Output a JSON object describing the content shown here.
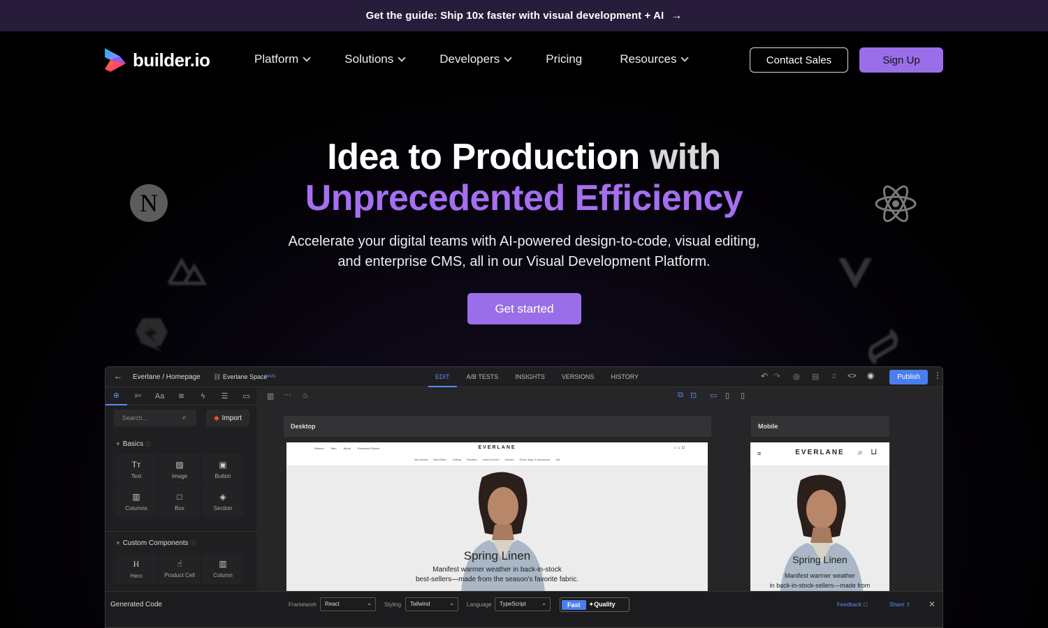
{
  "announcement": {
    "text": "Get the guide: Ship 10x faster with visual development + AI",
    "arrow": "→"
  },
  "nav": {
    "logo_text": "builder.io",
    "items": [
      {
        "label": "Platform",
        "dropdown": true
      },
      {
        "label": "Solutions",
        "dropdown": true
      },
      {
        "label": "Developers",
        "dropdown": true
      },
      {
        "label": "Pricing",
        "dropdown": false
      },
      {
        "label": "Resources",
        "dropdown": true
      }
    ],
    "contact_label": "Contact Sales",
    "signup_label": "Sign Up"
  },
  "hero": {
    "title_part1": "Idea to Production",
    "title_part2": "with",
    "title_line2": "Unprecedented Efficiency",
    "subtitle": "Accelerate your digital teams with AI-powered design-to-code, visual editing, and enterprise CMS, all in our Visual Development Platform.",
    "cta_label": "Get started"
  },
  "framework_icons": [
    "nextjs-icon",
    "react-icon",
    "vue-icon",
    "nuxt-icon",
    "qwik-icon",
    "svelte-icon"
  ],
  "colors": {
    "accent": "#9a6ee8",
    "title_purple": "#a56ff0",
    "announce_bg": "#271c3a",
    "publish_blue": "#4a7ef0"
  },
  "app": {
    "breadcrumb": "Everlane / Homepage",
    "space": "Everlane Space",
    "space_badge": "MAIN",
    "tabs": [
      "EDIT",
      "A/B TESTS",
      "INSIGHTS",
      "VERSIONS",
      "HISTORY"
    ],
    "active_tab": "EDIT",
    "publish_label": "Publish",
    "search_placeholder": "Search...",
    "import_label": "Import",
    "basics_title": "Basics",
    "basics": [
      "Text",
      "Image",
      "Button",
      "Columns",
      "Box",
      "Section"
    ],
    "custom_title": "Custom Components",
    "custom": [
      "Hero",
      "Product Cell",
      "Column"
    ],
    "desktop_label": "Desktop",
    "mobile_label": "Mobile",
    "site_brand": "EVERLANE",
    "site_nav": [
      "Women",
      "Men",
      "About",
      "Everworld Stories"
    ],
    "site_subnav": [
      "New Arrivals",
      "Best-Sellers",
      "Clothing",
      "Sweaters",
      "Jeans & Denim",
      "Dresses",
      "Shoes, Bags, & Accessories",
      "Sale"
    ],
    "hero_heading": "Spring Linen",
    "hero_text_1": "Manifest warmer weather in back-in-stock",
    "hero_text_2": "best-sellers—made from the season's favorite fabric.",
    "mobile_text_1": "Manifest warmer weather",
    "mobile_text_2": "in back-in-stock-sellers—made from",
    "generated_code": "Generated Code",
    "framework_label": "Framework",
    "framework_value": "React",
    "styling_label": "Styling",
    "styling_value": "Tailwind",
    "language_label": "Language",
    "language_value": "TypeScript",
    "fast_label": "Fast",
    "quality_label": "Quality",
    "feedback_label": "Feedback",
    "share_label": "Share"
  }
}
